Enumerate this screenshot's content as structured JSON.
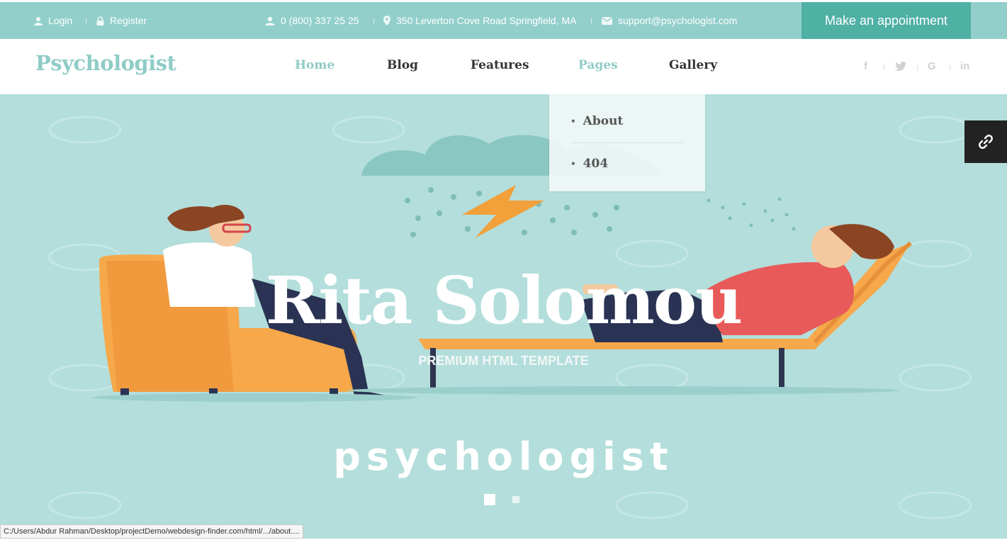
{
  "topbar": {
    "login": "Login",
    "register": "Register",
    "phone": "0 (800) 337 25 25",
    "address": "350 Leverton Cove Road Springfield, MA",
    "email": "support@psychologist.com",
    "appointment": "Make an appointment",
    "bg_color": "#92cfcb",
    "button_color": "#4fb0a4"
  },
  "nav": {
    "logo": "Psychologist",
    "items": [
      {
        "label": "Home",
        "active": true
      },
      {
        "label": "Blog",
        "active": false
      },
      {
        "label": "Features",
        "active": false
      },
      {
        "label": "Pages",
        "active": true
      },
      {
        "label": "Gallery",
        "active": false
      }
    ],
    "social": [
      "f",
      "twitter-icon",
      "G",
      "in"
    ],
    "accent_color": "#8fccc6"
  },
  "dropdown": {
    "items": [
      "About",
      "404"
    ]
  },
  "hero": {
    "title": "Rita Solomou",
    "subtitle": "PREMIUM HTML TEMPLATE",
    "word": "psychologist",
    "slides": 2,
    "active_slide": 1,
    "bg_color": "#b3dedb"
  },
  "statusbar": {
    "url": "C:/Users/Abdur Rahman/Desktop/projectDemo/webdesign-finder.com/html/.../about...."
  }
}
